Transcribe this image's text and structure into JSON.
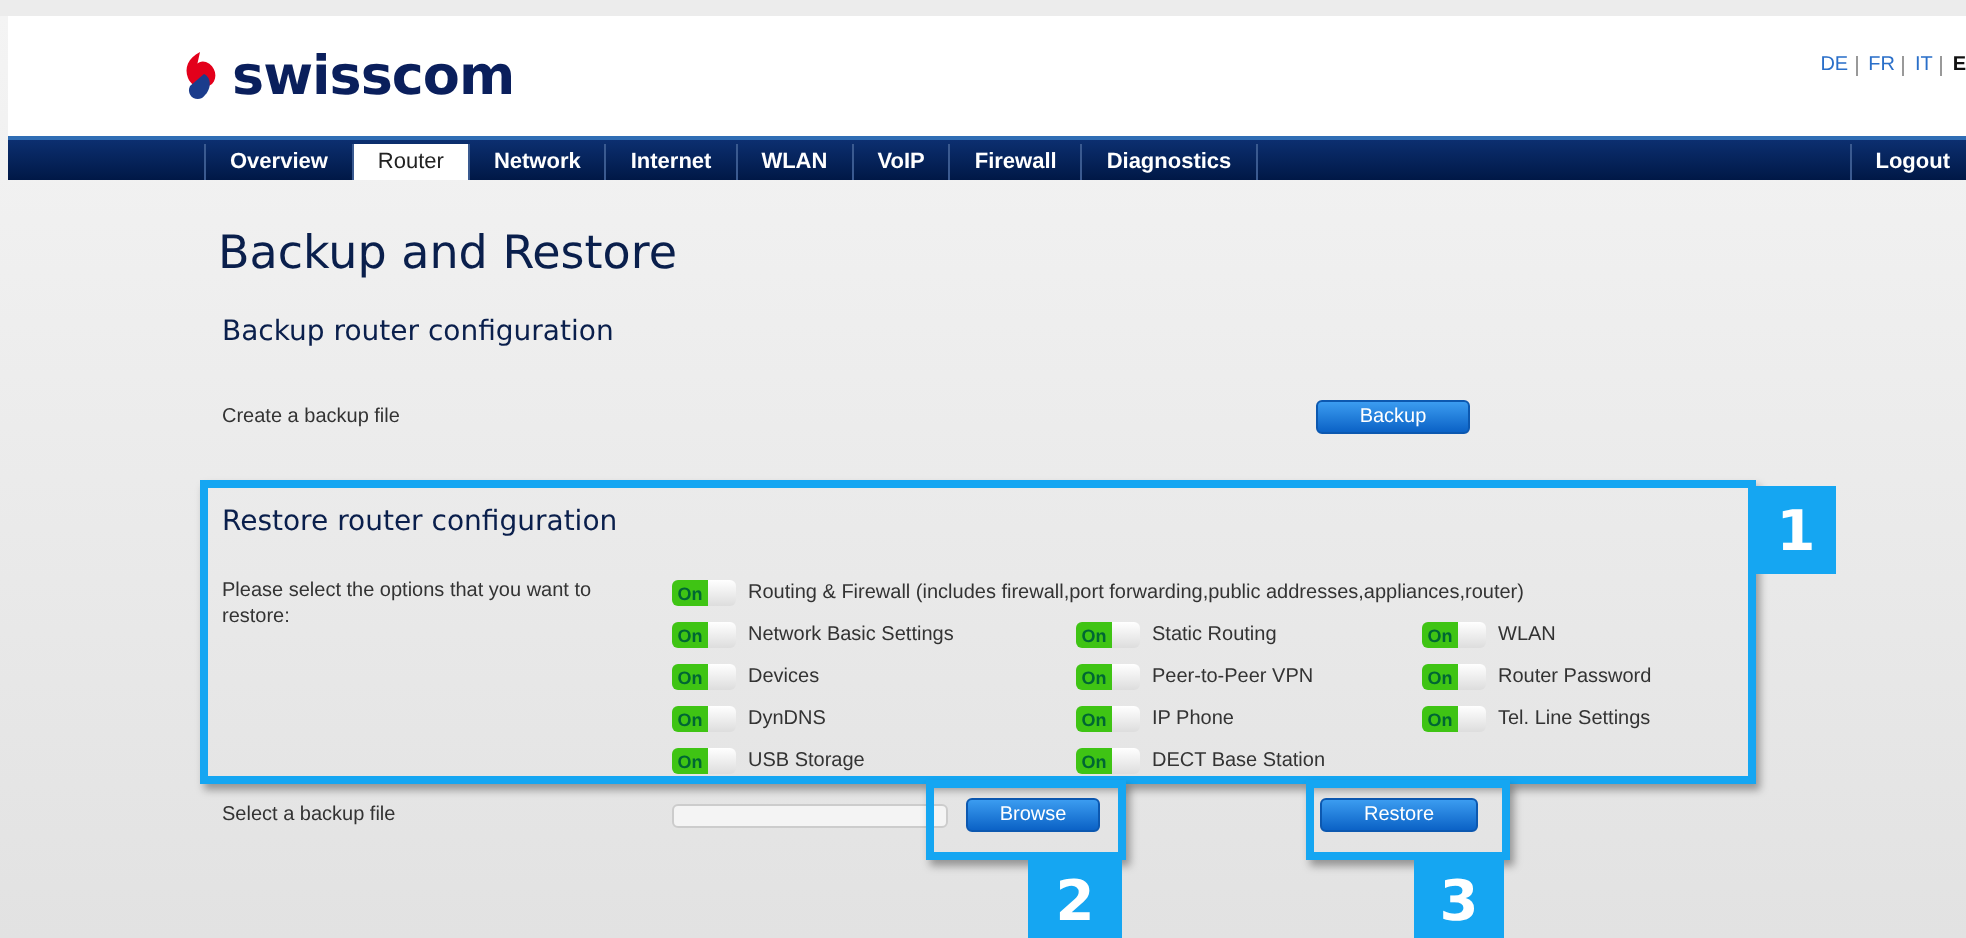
{
  "header": {
    "logo": "swisscom",
    "languages": [
      {
        "label": "DE",
        "selected": false
      },
      {
        "label": "FR",
        "selected": false
      },
      {
        "label": "IT",
        "selected": false
      },
      {
        "label": "E",
        "selected": true
      }
    ]
  },
  "nav": {
    "tabs": [
      {
        "label": "Overview",
        "selected": false
      },
      {
        "label": "Router",
        "selected": true
      },
      {
        "label": "Network",
        "selected": false
      },
      {
        "label": "Internet",
        "selected": false
      },
      {
        "label": "WLAN",
        "selected": false
      },
      {
        "label": "VoIP",
        "selected": false
      },
      {
        "label": "Firewall",
        "selected": false
      },
      {
        "label": "Diagnostics",
        "selected": false
      }
    ],
    "logout": "Logout"
  },
  "title": "Backup and Restore",
  "backup": {
    "heading": "Backup router configuration",
    "label": "Create a backup file",
    "button": "Backup"
  },
  "restore": {
    "heading": "Restore router configuration",
    "prompt": "Please select the options that you want to restore:",
    "main_option": {
      "label": "Routing & Firewall (includes firewall,port forwarding,public addresses,appliances,router)",
      "on": true,
      "state_label": "On"
    },
    "options": [
      {
        "label": "Network Basic Settings",
        "on": true,
        "state_label": "On"
      },
      {
        "label": "Static Routing",
        "on": true,
        "state_label": "On"
      },
      {
        "label": "WLAN",
        "on": true,
        "state_label": "On"
      },
      {
        "label": "Devices",
        "on": true,
        "state_label": "On"
      },
      {
        "label": "Peer-to-Peer VPN",
        "on": true,
        "state_label": "On"
      },
      {
        "label": "Router Password",
        "on": true,
        "state_label": "On"
      },
      {
        "label": "DynDNS",
        "on": true,
        "state_label": "On"
      },
      {
        "label": "IP Phone",
        "on": true,
        "state_label": "On"
      },
      {
        "label": "Tel. Line Settings",
        "on": true,
        "state_label": "On"
      },
      {
        "label": "USB Storage",
        "on": true,
        "state_label": "On"
      },
      {
        "label": "DECT Base Station",
        "on": true,
        "state_label": "On"
      }
    ],
    "file_label": "Select a backup file",
    "browse_button": "Browse",
    "restore_button": "Restore"
  },
  "callouts": [
    {
      "number": "1"
    },
    {
      "number": "2"
    },
    {
      "number": "3"
    }
  ]
}
